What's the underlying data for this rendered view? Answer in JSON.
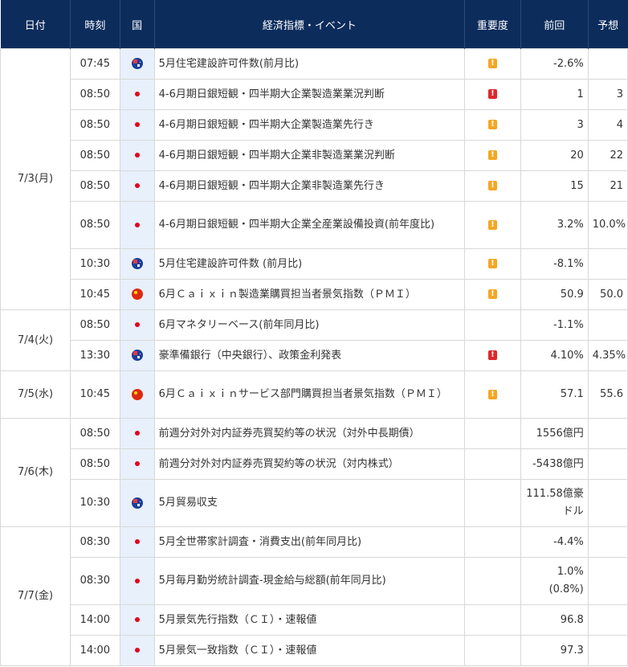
{
  "headers": {
    "date": "日付",
    "time": "時刻",
    "country": "国",
    "event": "経済指標・イベント",
    "importance": "重要度",
    "previous": "前回",
    "forecast": "予想"
  },
  "importance_glyph": "!",
  "colors": {
    "header_bg": "#0c2c5c",
    "flag_column_bg": "#e8f0fb",
    "importance_mid": "#f5a623",
    "importance_high": "#e0262a"
  },
  "days": [
    {
      "date": "7/3(月)",
      "rows": [
        {
          "time": "07:45",
          "flag": "australia-flag-icon",
          "event": "5月住宅建設許可件数(前月比)",
          "importance": "mid",
          "previous": "-2.6%",
          "forecast": "",
          "h": 38
        },
        {
          "time": "08:50",
          "flag": "japan-flag-icon",
          "event": "4-6月期日銀短観・四半期大企業製造業業況判断",
          "importance": "high",
          "previous": "1",
          "forecast": "3",
          "h": 38
        },
        {
          "time": "08:50",
          "flag": "japan-flag-icon",
          "event": "4-6月期日銀短観・四半期大企業製造業先行き",
          "importance": "mid",
          "previous": "3",
          "forecast": "4",
          "h": 38
        },
        {
          "time": "08:50",
          "flag": "japan-flag-icon",
          "event": "4-6月期日銀短観・四半期大企業非製造業業況判断",
          "importance": "mid",
          "previous": "20",
          "forecast": "22",
          "h": 38
        },
        {
          "time": "08:50",
          "flag": "japan-flag-icon",
          "event": "4-6月期日銀短観・四半期大企業非製造業先行き",
          "importance": "mid",
          "previous": "15",
          "forecast": "21",
          "h": 38
        },
        {
          "time": "08:50",
          "flag": "japan-flag-icon",
          "event": "4-6月期日銀短観・四半期大企業全産業設備投資(前年度比)",
          "importance": "mid",
          "previous": "3.2%",
          "forecast": "10.0%",
          "h": 59
        },
        {
          "time": "10:30",
          "flag": "australia-flag-icon",
          "event": "5月住宅建設許可件数 (前月比)",
          "importance": "mid",
          "previous": "-8.1%",
          "forecast": "",
          "h": 38
        },
        {
          "time": "10:45",
          "flag": "china-flag-icon",
          "event": "6月Ｃａｉｘｉｎ製造業購買担当者景気指数（ＰＭＩ）",
          "importance": "mid",
          "previous": "50.9",
          "forecast": "50.0",
          "h": 38
        }
      ]
    },
    {
      "date": "7/4(火)",
      "rows": [
        {
          "time": "08:50",
          "flag": "japan-flag-icon",
          "event": "6月マネタリーベース(前年同月比)",
          "importance": "",
          "previous": "-1.1%",
          "forecast": "",
          "h": 38
        },
        {
          "time": "13:30",
          "flag": "australia-flag-icon",
          "event": "豪準備銀行（中央銀行）、政策金利発表",
          "importance": "high",
          "previous": "4.10%",
          "forecast": "4.35%",
          "h": 38
        }
      ]
    },
    {
      "date": "7/5(水)",
      "rows": [
        {
          "time": "10:45",
          "flag": "china-flag-icon",
          "event": "6月Ｃａｉｘｉｎサービス部門購買担当者景気指数（ＰＭＩ）",
          "importance": "mid",
          "previous": "57.1",
          "forecast": "55.6",
          "h": 59
        }
      ]
    },
    {
      "date": "7/6(木)",
      "rows": [
        {
          "time": "08:50",
          "flag": "japan-flag-icon",
          "event": "前週分対外対内証券売買契約等の状況（対外中長期債）",
          "importance": "",
          "previous": "1556億円",
          "forecast": "",
          "h": 38
        },
        {
          "time": "08:50",
          "flag": "japan-flag-icon",
          "event": "前週分対外対内証券売買契約等の状況（対内株式）",
          "importance": "",
          "previous": "-5438億円",
          "forecast": "",
          "h": 38
        },
        {
          "time": "10:30",
          "flag": "australia-flag-icon",
          "event": "5月貿易収支",
          "importance": "",
          "previous": "111.58億豪ドル",
          "forecast": "",
          "h": 59
        }
      ]
    },
    {
      "date": "7/7(金)",
      "rows": [
        {
          "time": "08:30",
          "flag": "japan-flag-icon",
          "event": "5月全世帯家計調査・消費支出(前年同月比)",
          "importance": "",
          "previous": "-4.4%",
          "forecast": "",
          "h": 38
        },
        {
          "time": "08:30",
          "flag": "japan-flag-icon",
          "event": "5月毎月勤労統計調査-現金給与総額(前年同月比)",
          "importance": "",
          "previous": "1.0%\n(0.8%)",
          "forecast": "",
          "h": 59
        },
        {
          "time": "14:00",
          "flag": "japan-flag-icon",
          "event": "5月景気先行指数（ＣＩ）・速報値",
          "importance": "",
          "previous": "96.8",
          "forecast": "",
          "h": 38
        },
        {
          "time": "14:00",
          "flag": "japan-flag-icon",
          "event": "5月景気一致指数（ＣＩ）・速報値",
          "importance": "",
          "previous": "97.3",
          "forecast": "",
          "h": 38
        }
      ]
    }
  ]
}
